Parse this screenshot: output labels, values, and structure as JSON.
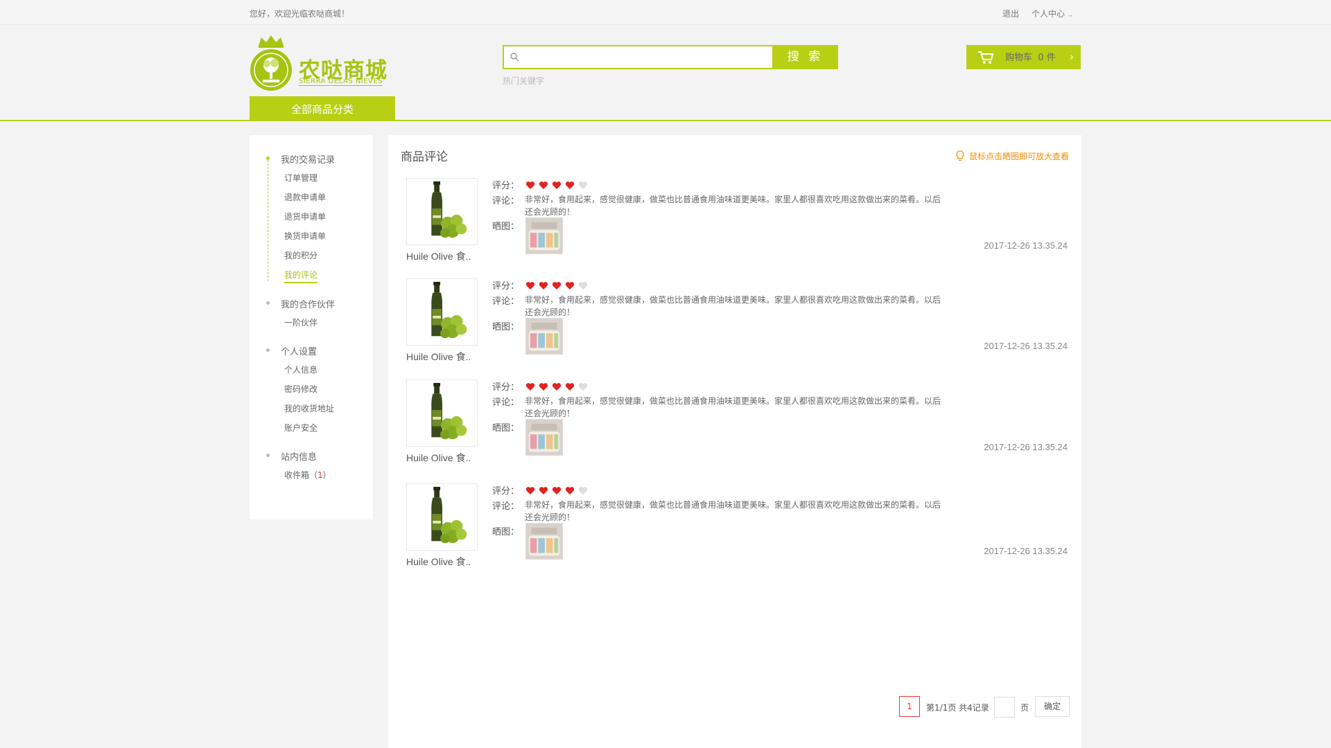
{
  "colors": {
    "brand": "#b9cf14",
    "accent_red": "#e33333",
    "tip": "#f08c00"
  },
  "topbar": {
    "welcome": "您好，欢迎光临农哒商城！",
    "logout": "退出",
    "personal_center": "个人中心"
  },
  "header": {
    "logo_cn": "农哒商城",
    "logo_en": "SIERRA DELAS NIEVES",
    "search_button": "搜 索",
    "search_value": "",
    "hot_keywords": "热门关键字",
    "cart_label": "购物车",
    "cart_count": "0 件",
    "all_categories": "全部商品分类"
  },
  "sidebar": {
    "groups": [
      {
        "title": "我的交易记录",
        "items": [
          "订单管理",
          "退款申请单",
          "退货申请单",
          "换货申请单",
          "我的积分",
          "我的评论"
        ]
      },
      {
        "title": "我的合作伙伴",
        "items": [
          "一阶伙伴"
        ]
      },
      {
        "title": "个人设置",
        "items": [
          "个人信息",
          "密码修改",
          "我的收货地址",
          "账户安全"
        ]
      },
      {
        "title": "站内信息",
        "items": [
          "收件箱"
        ]
      }
    ],
    "active_item": "我的评论",
    "inbox_prefix": "收件箱（",
    "inbox_count": "1",
    "inbox_suffix": "）"
  },
  "main": {
    "title": "商品评论",
    "tip": "鼠标点击晒图即可放大查看",
    "labels": {
      "rating": "评分：",
      "comment": "评论：",
      "photos": "晒图："
    },
    "reviews": [
      {
        "product_name": "Huile Olive 食..",
        "rating": 4,
        "max_rating": 5,
        "comment": "非常好，食用起来，感觉很健康，做菜也比普通食用油味道更美味。家里人都很喜欢吃用这款做出来的菜肴。以后还会光顾的！",
        "date": "2017-12-26 13.35.24"
      },
      {
        "product_name": "Huile Olive 食..",
        "rating": 4,
        "max_rating": 5,
        "comment": "非常好，食用起来，感觉很健康，做菜也比普通食用油味道更美味。家里人都很喜欢吃用这款做出来的菜肴。以后还会光顾的！",
        "date": "2017-12-26 13.35.24"
      },
      {
        "product_name": "Huile Olive 食..",
        "rating": 4,
        "max_rating": 5,
        "comment": "非常好，食用起来，感觉很健康，做菜也比普通食用油味道更美味。家里人都很喜欢吃用这款做出来的菜肴。以后还会光顾的！",
        "date": "2017-12-26 13.35.24"
      },
      {
        "product_name": "Huile Olive 食..",
        "rating": 4,
        "max_rating": 5,
        "comment": "非常好，食用起来，感觉很健康，做菜也比普通食用油味道更美味。家里人都很喜欢吃用这款做出来的菜肴。以后还会光顾的！",
        "date": "2017-12-26 13.35.24"
      }
    ]
  },
  "pagination": {
    "current": "1",
    "info": "第1/1页 共4记录",
    "page_input": "",
    "page_unit": "页",
    "confirm": "确定"
  }
}
